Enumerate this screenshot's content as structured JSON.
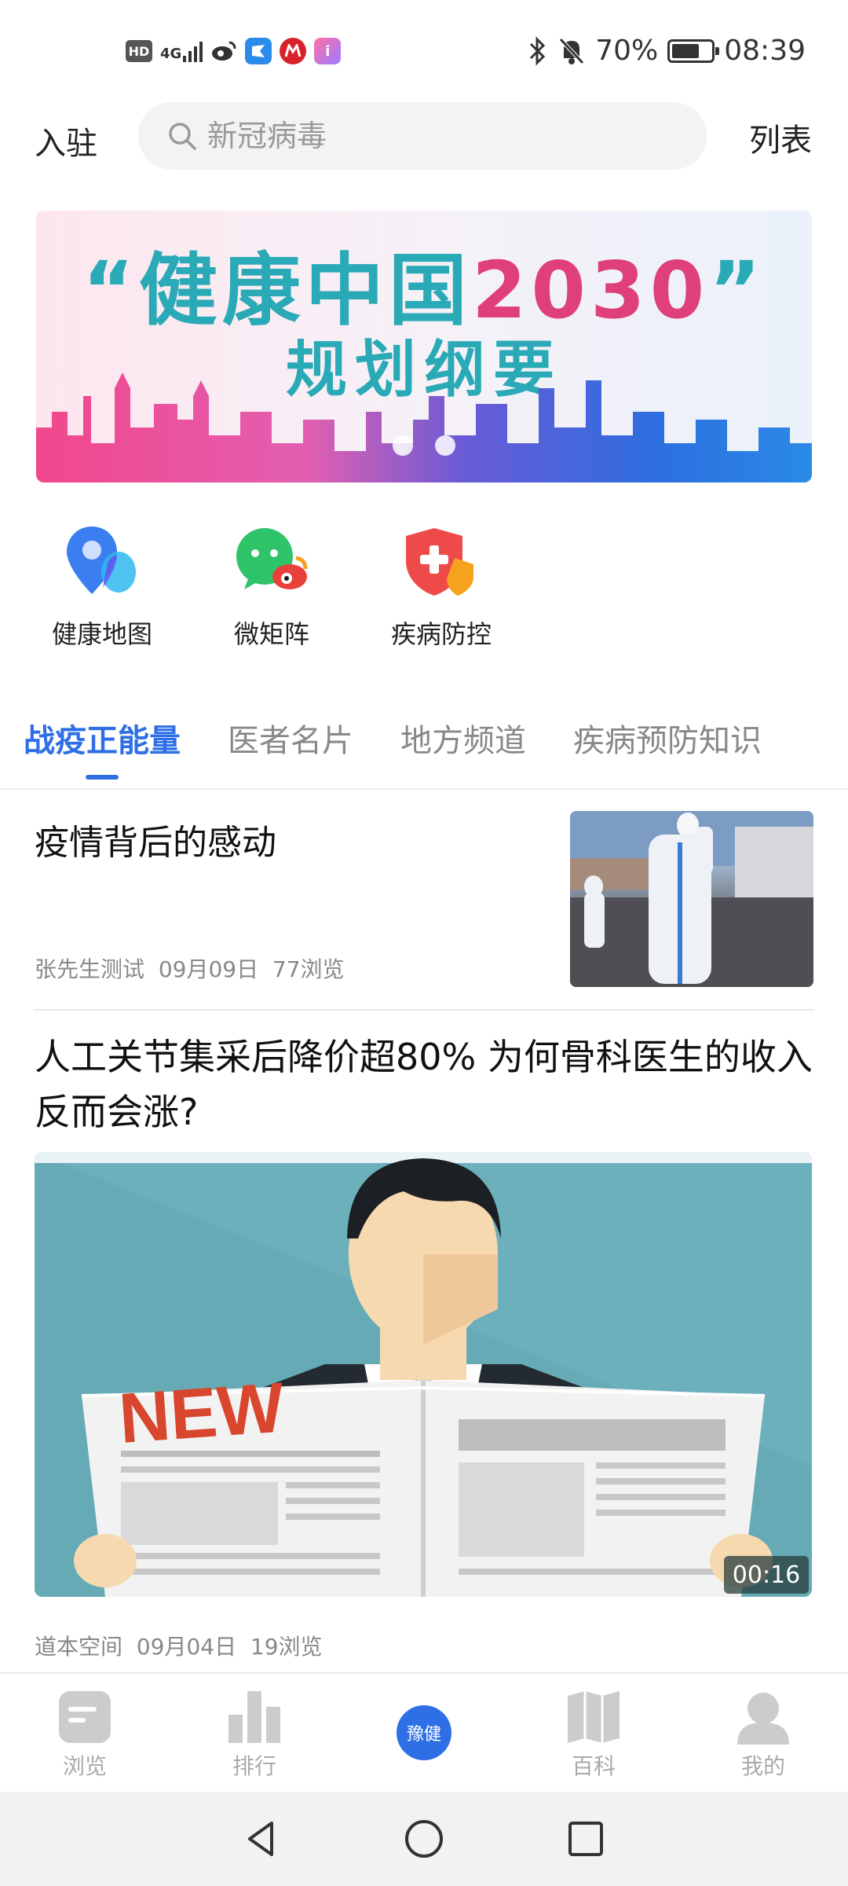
{
  "status_bar": {
    "hd": "HD",
    "network": "4G",
    "battery_text": "70%",
    "battery_level": 0.7,
    "time": "08:39"
  },
  "header": {
    "enter_label": "入驻",
    "search_placeholder": "新冠病毒",
    "list_label": "列表"
  },
  "banner": {
    "title_part1": "“健康中国",
    "title_number": "2030",
    "title_part2": "”",
    "subtitle": "规划纲要",
    "active_dot": 1,
    "dot_count": 2
  },
  "quick_actions": [
    {
      "label": "健康地图",
      "icon": "map-pin-icon"
    },
    {
      "label": "微矩阵",
      "icon": "wechat-weibo-icon"
    },
    {
      "label": "疾病防控",
      "icon": "shield-plus-icon"
    }
  ],
  "tabs": [
    {
      "label": "战疫正能量",
      "active": true
    },
    {
      "label": "医者名片",
      "active": false
    },
    {
      "label": "地方频道",
      "active": false
    },
    {
      "label": "疾病预防知识",
      "active": false
    }
  ],
  "articles": [
    {
      "title": "疫情背后的感动",
      "author": "张先生测试",
      "date": "09月09日",
      "views": "77浏览"
    },
    {
      "title": "人工关节集采后降价超80% 为何骨科医生的收入反而会涨?",
      "author": "道本空间",
      "date": "09月04日",
      "views": "19浏览",
      "image_text": "NEW",
      "duration": "00:16"
    }
  ],
  "bottom_nav": [
    {
      "label": "浏览",
      "icon": "browse-icon"
    },
    {
      "label": "排行",
      "icon": "ranking-icon"
    },
    {
      "label": "豫健",
      "icon": "center-logo"
    },
    {
      "label": "百科",
      "icon": "book-icon"
    },
    {
      "label": "我的",
      "icon": "profile-icon"
    }
  ],
  "colors": {
    "accent": "#2f6fe6",
    "banner_teal": "#2aa9b6",
    "banner_pink": "#e0407a"
  }
}
